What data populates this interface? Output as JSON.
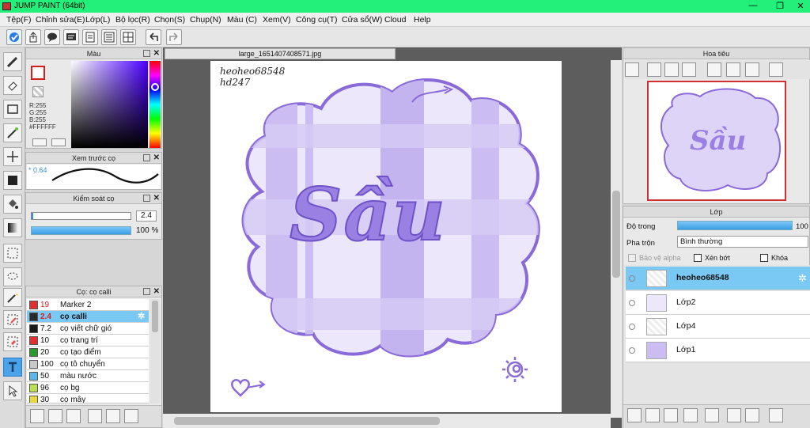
{
  "window": {
    "title": "JUMP PAINT (64bit)",
    "min": "—",
    "max": "❐",
    "close": "✕"
  },
  "menu": [
    "Tệp(F)",
    "Chỉnh sửa(E)",
    "Lớp(L)",
    "Bộ lọc(R)",
    "Chọn(S)",
    "Chụp(N)",
    "Màu (C)",
    "Xem(V)",
    "Công cụ(T)",
    "Cửa sổ(W)",
    "Cloud",
    "Help"
  ],
  "color_panel": {
    "title": "Màu",
    "r": "R:255",
    "g": "G:255",
    "b": "B:255",
    "hex": "#FFFFFF"
  },
  "brush_preview": {
    "title": "Xem trước cọ",
    "size": "* 0.64"
  },
  "brush_control": {
    "title": "Kiểm soát cọ",
    "size_value": "2.4",
    "opacity_value": "100 %"
  },
  "brush_list": {
    "title": "Cọ: cọ calli",
    "items": [
      {
        "size": "19",
        "name": "Marker 2",
        "color": "#e03030"
      },
      {
        "size": "2.4",
        "name": "cọ calli",
        "color": "#2a2a2a",
        "selected": true
      },
      {
        "size": "7.2",
        "name": "cọ viết chữ gió",
        "color": "#1a1a1a"
      },
      {
        "size": "10",
        "name": "cọ trang trí",
        "color": "#e03030"
      },
      {
        "size": "20",
        "name": "cọ tạo điểm",
        "color": "#2a9a2a"
      },
      {
        "size": "100",
        "name": "cọ tô chuyển",
        "color": "#c8c8c8"
      },
      {
        "size": "50",
        "name": "màu nước",
        "color": "#5ab8e8"
      },
      {
        "size": "96",
        "name": "cọ bg",
        "color": "#b8e050"
      },
      {
        "size": "30",
        "name": "cọ mây",
        "color": "#e8d840"
      }
    ]
  },
  "document": {
    "tab": "large_1651407408571.jpg",
    "sig1": "heoheo68548",
    "sig2": "hd247",
    "art_text": "Sầu"
  },
  "navigator": {
    "title": "Hoa tiêu"
  },
  "layers": {
    "title": "Lớp",
    "opacity_label": "Độ trong",
    "opacity_value": "100",
    "blend_label": "Pha trộn",
    "blend_value": "Bình thường",
    "protect_alpha": "Bảo vệ alpha",
    "clip": "Xén bớt",
    "lock": "Khóa",
    "items": [
      {
        "name": "heoheo68548",
        "selected": true
      },
      {
        "name": "Lớp2"
      },
      {
        "name": "Lớp4"
      },
      {
        "name": "Lớp1"
      }
    ]
  },
  "colors": {
    "title_bar": "#22f07a",
    "selected": "#7ac8f4",
    "art_purple": "#8a6ad8"
  }
}
